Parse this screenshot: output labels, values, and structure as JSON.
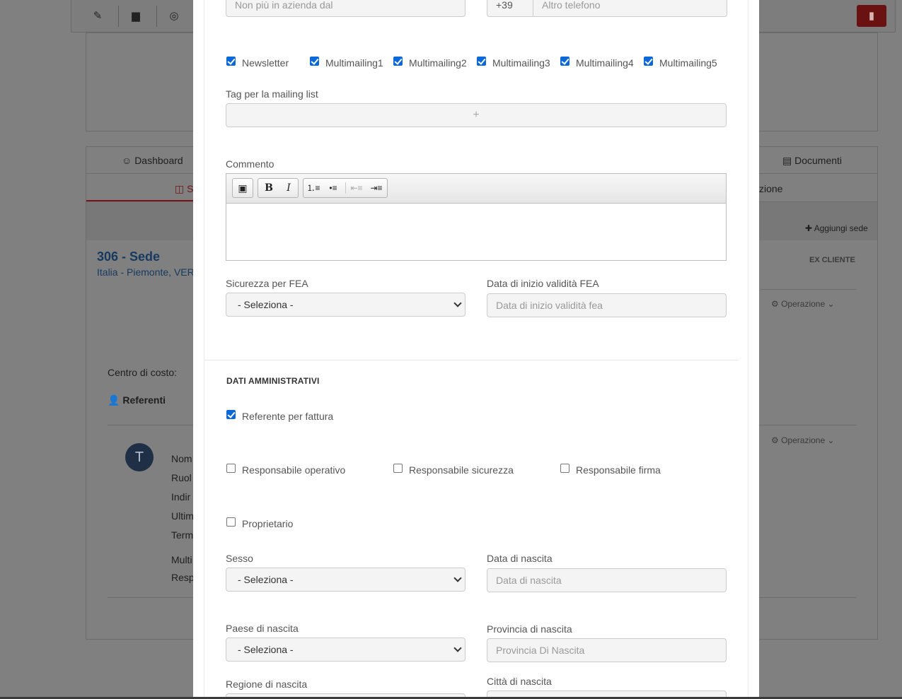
{
  "background": {
    "tabs": {
      "dashboard": "Dashboard",
      "documenti": "Documenti",
      "sedi_partial": "S",
      "zione_partial": "zione"
    },
    "add_site": "Aggiungi sede",
    "site_title": "306 - Sede",
    "site_address": "Italia - Piemonte, VER",
    "status_badge": "EX CLIENTE",
    "operation": "Operazione",
    "cost_center": "Centro di costo:",
    "referents": "Referenti",
    "avatar_initial": "T",
    "contact_labels": [
      "Nom",
      "Ruol",
      "Indir",
      "Ultim",
      "Term",
      "Multi",
      "Resp"
    ]
  },
  "form": {
    "non_piu": {
      "placeholder": "Non più in azienda dal"
    },
    "phone": {
      "prefix": "+39",
      "placeholder": "Altro telefono"
    },
    "mailing_checks": [
      {
        "label": "Newsletter",
        "checked": true
      },
      {
        "label": "Multimailing1",
        "checked": true
      },
      {
        "label": "Multimailing2",
        "checked": true
      },
      {
        "label": "Multimailing3",
        "checked": true
      },
      {
        "label": "Multimailing4",
        "checked": true
      },
      {
        "label": "Multimailing5",
        "checked": true
      }
    ],
    "tag_label": "Tag per la mailing list",
    "tag_add": "+",
    "comment_label": "Commento",
    "fea_security": {
      "label": "Sicurezza per FEA",
      "value": "- Seleziona -"
    },
    "fea_start": {
      "label": "Data di inizio validità FEA",
      "placeholder": "Data di inizio validità fea"
    },
    "admin_section": "DATI AMMINISTRATIVI",
    "referente_fattura": {
      "label": "Referente per fattura",
      "checked": true
    },
    "resp_operativo": {
      "label": "Responsabile operativo",
      "checked": false
    },
    "resp_sicurezza": {
      "label": "Responsabile sicurezza",
      "checked": false
    },
    "resp_firma": {
      "label": "Responsabile firma",
      "checked": false
    },
    "proprietario": {
      "label": "Proprietario",
      "checked": false
    },
    "sesso": {
      "label": "Sesso",
      "value": "- Seleziona -"
    },
    "data_nascita": {
      "label": "Data di nascita",
      "placeholder": "Data di nascita"
    },
    "paese_nascita": {
      "label": "Paese di nascita",
      "value": "- Seleziona -"
    },
    "provincia_nascita": {
      "label": "Provincia di nascita",
      "placeholder": "Provincia Di Nascita"
    },
    "regione_nascita": {
      "label": "Regione di nascita"
    },
    "citta_nascita": {
      "label": "Città di nascita"
    }
  }
}
